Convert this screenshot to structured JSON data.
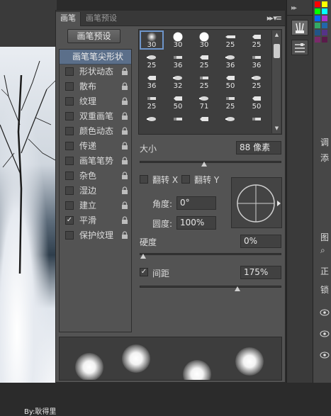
{
  "panel": {
    "tabs": [
      {
        "label": "画笔",
        "active": true
      },
      {
        "label": "画笔预设",
        "active": false
      }
    ],
    "menu_glyph": "▸▸ ▾≡",
    "preset_button": "画笔预设"
  },
  "settings": [
    {
      "label": "画笔笔尖形状",
      "header": true,
      "checked": false,
      "locked": false
    },
    {
      "label": "形状动态",
      "checked": false,
      "locked": true
    },
    {
      "label": "散布",
      "checked": false,
      "locked": true
    },
    {
      "label": "纹理",
      "checked": false,
      "locked": true
    },
    {
      "label": "双重画笔",
      "checked": false,
      "locked": true
    },
    {
      "label": "颜色动态",
      "checked": false,
      "locked": true
    },
    {
      "label": "传递",
      "checked": false,
      "locked": true
    },
    {
      "label": "画笔笔势",
      "checked": false,
      "locked": true
    },
    {
      "label": "杂色",
      "checked": false,
      "locked": true
    },
    {
      "label": "湿边",
      "checked": false,
      "locked": true
    },
    {
      "label": "建立",
      "checked": false,
      "locked": true
    },
    {
      "label": "平滑",
      "checked": true,
      "locked": true
    },
    {
      "label": "保护纹理",
      "checked": false,
      "locked": true
    }
  ],
  "brush_tips": [
    {
      "size": "30",
      "shape": "soft-round",
      "selected": true
    },
    {
      "size": "30",
      "shape": "hard-round"
    },
    {
      "size": "30",
      "shape": "hard-round"
    },
    {
      "size": "25",
      "shape": "pencil"
    },
    {
      "size": "25",
      "shape": "brush"
    },
    {
      "size": "25",
      "shape": "brush"
    },
    {
      "size": "36",
      "shape": "brush"
    },
    {
      "size": "25",
      "shape": "brush"
    },
    {
      "size": "36",
      "shape": "brush"
    },
    {
      "size": "36",
      "shape": "brush"
    },
    {
      "size": "36",
      "shape": "brush"
    },
    {
      "size": "32",
      "shape": "brush"
    },
    {
      "size": "25",
      "shape": "brush"
    },
    {
      "size": "50",
      "shape": "brush"
    },
    {
      "size": "25",
      "shape": "brush"
    },
    {
      "size": "25",
      "shape": "brush"
    },
    {
      "size": "50",
      "shape": "brush"
    },
    {
      "size": "71",
      "shape": "brush"
    },
    {
      "size": "25",
      "shape": "brush"
    },
    {
      "size": "50",
      "shape": "brush"
    },
    {
      "size": "",
      "shape": "brush"
    },
    {
      "size": "",
      "shape": "brush"
    },
    {
      "size": "",
      "shape": "brush"
    },
    {
      "size": "",
      "shape": "brush"
    },
    {
      "size": "",
      "shape": "brush"
    }
  ],
  "brush_tip": {
    "size_label": "大小",
    "size_value": "88 像素",
    "size_slider": 0.45,
    "flip_x_label": "翻转 X",
    "flip_y_label": "翻转 Y",
    "flip_x": false,
    "flip_y": false,
    "angle_label": "角度:",
    "angle_value": "0°",
    "roundness_label": "圆度:",
    "roundness_value": "100%",
    "hardness_label": "硬度",
    "hardness_value": "0%",
    "hardness_slider": 0.0,
    "spacing_label": "间距",
    "spacing_value": "175%",
    "spacing_checked": true,
    "spacing_slider": 0.7
  },
  "right_panel": {
    "labels": [
      "调",
      "添",
      "图",
      "正",
      "锁"
    ]
  },
  "canvas": {
    "watermark": "By:耿得里"
  },
  "colors": {
    "panel_bg": "#535353",
    "selection": "#5b6f8a",
    "field_bg": "#414141"
  }
}
